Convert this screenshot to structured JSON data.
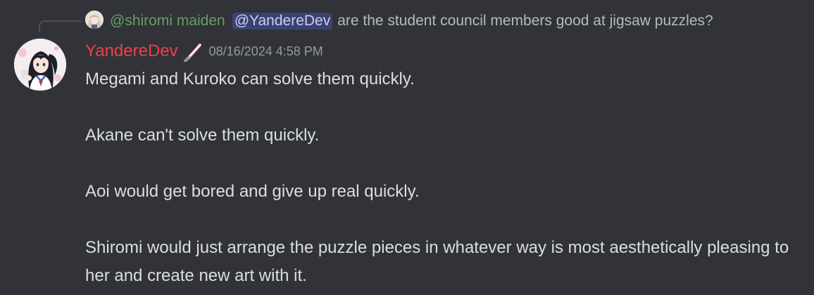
{
  "reply": {
    "author": "@shiromi maiden",
    "mention": "@YandereDev",
    "text": "are the student council members good at jigsaw puzzles?"
  },
  "message": {
    "author": "YandereDev",
    "author_color": "#f23f43",
    "role_icon": "red-lightsaber-icon",
    "timestamp": "08/16/2024 4:58 PM",
    "paragraphs": [
      "Megami and Kuroko can solve them quickly.",
      "Akane can't solve them quickly.",
      "Aoi would get bored and give up real quickly.",
      "Shiromi would just arrange the puzzle pieces in whatever way is most aesthetically pleasing to her and create new art with it."
    ]
  },
  "colors": {
    "background": "#313338",
    "text": "#dbdee1",
    "muted": "#949ba4",
    "mention_bg": "#3c4270",
    "mention_text": "#c9cdfb",
    "reply_author": "#6a9c64"
  }
}
